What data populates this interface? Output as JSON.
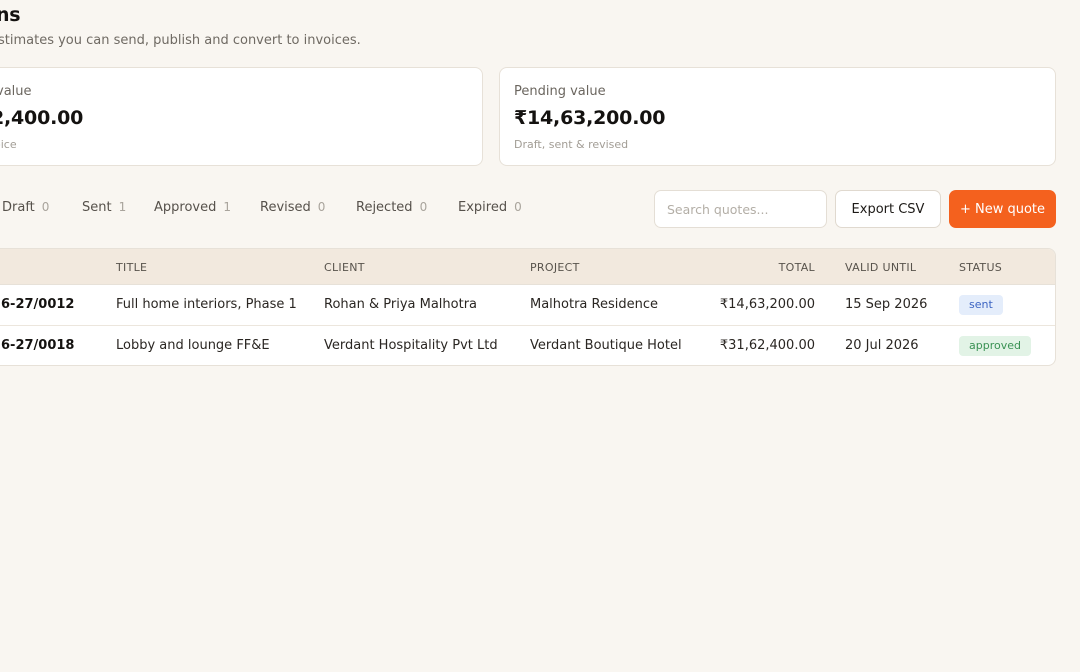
{
  "header": {
    "title": "ns",
    "subtitle": "stimates you can send, publish and convert to invoices."
  },
  "stats": {
    "left": {
      "label": "value",
      "value": "2,400.00",
      "note": "oice"
    },
    "right": {
      "label": "Pending value",
      "value": "₹14,63,200.00",
      "note": "Draft, sent & revised"
    }
  },
  "tabs": [
    {
      "label": "Draft",
      "count": "0"
    },
    {
      "label": "Sent",
      "count": "1"
    },
    {
      "label": "Approved",
      "count": "1"
    },
    {
      "label": "Revised",
      "count": "0"
    },
    {
      "label": "Rejected",
      "count": "0"
    },
    {
      "label": "Expired",
      "count": "0"
    }
  ],
  "toolbar": {
    "search_placeholder": "Search quotes...",
    "export_label": "Export CSV",
    "new_label": "+ New quote"
  },
  "table": {
    "columns": {
      "title": "TITLE",
      "client": "CLIENT",
      "project": "PROJECT",
      "total": "TOTAL",
      "valid_until": "VALID UNTIL",
      "status": "STATUS"
    },
    "rows": [
      {
        "number": "6-27/0012",
        "title": "Full home interiors, Phase 1",
        "client": "Rohan & Priya Malhotra",
        "project": "Malhotra Residence",
        "total": "₹14,63,200.00",
        "valid_until": "15 Sep 2026",
        "status": "sent"
      },
      {
        "number": "6-27/0018",
        "title": "Lobby and lounge FF&E",
        "client": "Verdant Hospitality Pvt Ltd",
        "project": "Verdant Boutique Hotel",
        "total": "₹31,62,400.00",
        "valid_until": "20 Jul 2026",
        "status": "approved"
      }
    ]
  },
  "colors": {
    "accent": "#f4611e",
    "background": "#f9f6f1",
    "table_header": "#f2e9de",
    "badge_sent": "#3c64c2",
    "badge_approved": "#3a9254"
  }
}
